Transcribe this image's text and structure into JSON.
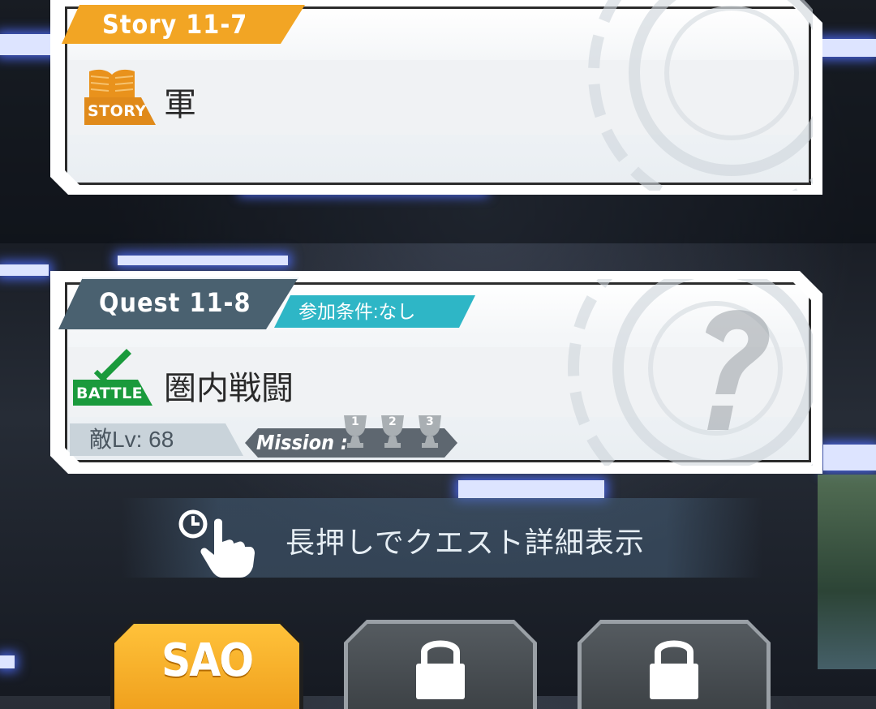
{
  "story_card": {
    "tag": "Story 11-7",
    "badge": "STORY",
    "title": "軍"
  },
  "quest_card": {
    "tag": "Quest 11-8",
    "condition": "参加条件:なし",
    "badge": "BATTLE",
    "title": "圏内戦闘",
    "enemy_level": "敵Lv: 68",
    "mission_label": "Mission :",
    "trophies": [
      "1",
      "2",
      "3"
    ]
  },
  "hint": {
    "text": "長押しでクエスト詳細表示"
  },
  "tabs": [
    {
      "label": "SAO",
      "state": "selected"
    },
    {
      "label": "",
      "state": "locked"
    },
    {
      "label": "",
      "state": "locked"
    }
  ],
  "colors": {
    "story_orange": "#f2a524",
    "quest_slate": "#4a6170",
    "condition_teal": "#2eb6c6",
    "battle_green": "#1a9a3c"
  }
}
